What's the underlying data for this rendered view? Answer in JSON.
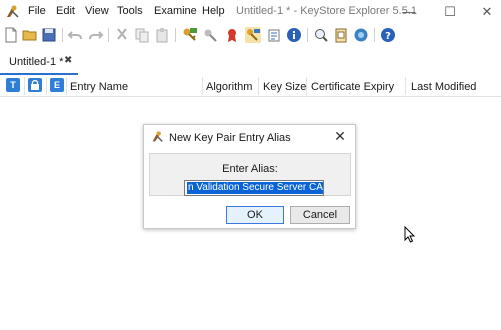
{
  "app": {
    "window_title": "Untitled-1 * - KeyStore Explorer 5.5.1",
    "logo_icon": "keystore-explorer-logo-icon"
  },
  "menu": {
    "items": [
      "File",
      "Edit",
      "View",
      "Tools",
      "Examine",
      "Help"
    ]
  },
  "window_controls": {
    "minimize": "—",
    "maximize": "☐",
    "close": "✕"
  },
  "toolbar": {
    "icons": [
      "new-icon",
      "open-icon",
      "save-icon",
      "undo-icon",
      "redo-icon",
      "cut-icon",
      "copy-icon",
      "paste-icon",
      "generate-key-pair-icon",
      "generate-secret-key-icon",
      "import-trusted-certificate-icon",
      "import-key-pair-icon",
      "set-password-icon",
      "keystore-properties-icon",
      "examine-file-icon",
      "examine-clipboard-icon",
      "examine-ssl-icon",
      "help-icon"
    ]
  },
  "tabs": [
    {
      "label": "Untitled-1 *",
      "close": "✖"
    }
  ],
  "table": {
    "icon_columns": [
      "T",
      "L",
      "E"
    ],
    "columns": [
      "Entry Name",
      "Algorithm",
      "Key Size",
      "Certificate Expiry",
      "Last Modified"
    ],
    "rows": []
  },
  "dialog": {
    "title": "New Key Pair Entry Alias",
    "close": "✕",
    "prompt": "Enter Alias:",
    "alias_value": "n Validation Secure Server CA)",
    "ok_label": "OK",
    "cancel_label": "Cancel"
  },
  "colors": {
    "accent": "#2b6fd0",
    "selection": "#0a64d8",
    "header_icon": "#2f7fd6"
  }
}
